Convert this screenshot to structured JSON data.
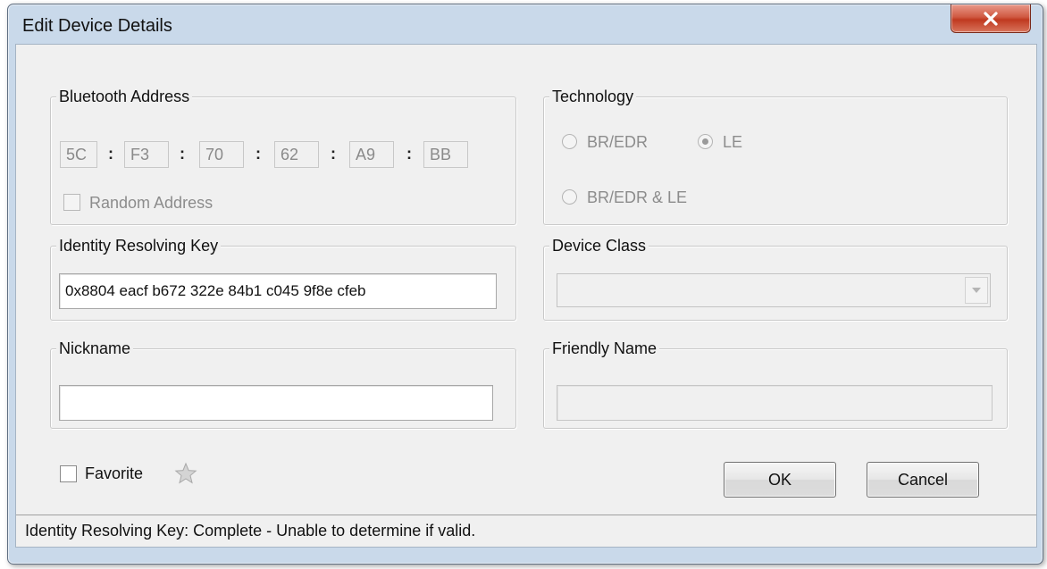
{
  "window": {
    "title": "Edit Device Details",
    "close_icon": "close-x-icon"
  },
  "bluetooth_address": {
    "label": "Bluetooth Address",
    "octets": [
      "5C",
      "F3",
      "70",
      "62",
      "A9",
      "BB"
    ],
    "separator": ":",
    "random_address_label": "Random Address",
    "random_address_checked": false
  },
  "technology": {
    "label": "Technology",
    "options": [
      {
        "label": "BR/EDR",
        "selected": false
      },
      {
        "label": "LE",
        "selected": true
      },
      {
        "label": "BR/EDR & LE",
        "selected": false
      }
    ]
  },
  "irk": {
    "label": "Identity Resolving Key",
    "value": "0x8804 eacf b672 322e 84b1 c045 9f8e cfeb"
  },
  "device_class": {
    "label": "Device Class",
    "value": ""
  },
  "nickname": {
    "label": "Nickname",
    "value": ""
  },
  "friendly_name": {
    "label": "Friendly Name",
    "value": ""
  },
  "favorite": {
    "label": "Favorite",
    "checked": false,
    "icon": "star-icon"
  },
  "buttons": {
    "ok": "OK",
    "cancel": "Cancel"
  },
  "status": {
    "text": "Identity Resolving Key: Complete - Unable to determine if valid."
  }
}
